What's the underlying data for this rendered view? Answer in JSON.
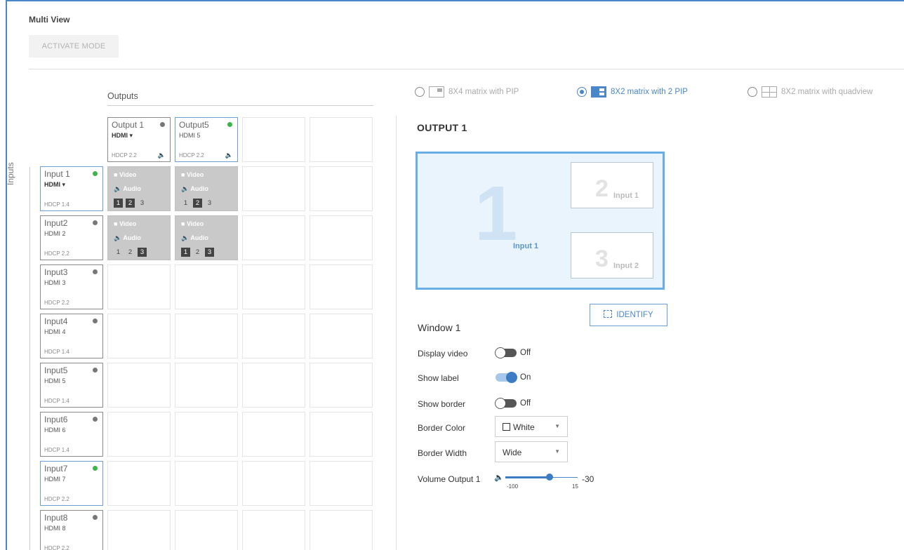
{
  "page": {
    "title": "Multi View",
    "activate_label": "ACTIVATE MODE"
  },
  "matrix": {
    "outputs_title": "Outputs",
    "inputs_label": "Inputs",
    "outputs": [
      {
        "name": "Output 1",
        "source": "HDMI ▾",
        "hdcp": "HDCP 2.2",
        "status": "gray"
      },
      {
        "name": "Output5",
        "source": "HDMI 5",
        "hdcp": "HDCP 2.2",
        "status": "green"
      }
    ],
    "inputs": [
      {
        "name": "Input 1",
        "source": "HDMI ▾",
        "hdcp": "HDCP 1.4",
        "status": "green"
      },
      {
        "name": "Input2",
        "source": "HDMI 2",
        "hdcp": "HDCP 2.2",
        "status": "gray"
      },
      {
        "name": "Input3",
        "source": "HDMI 3",
        "hdcp": "HDCP 2.2",
        "status": "gray"
      },
      {
        "name": "Input4",
        "source": "HDMI 4",
        "hdcp": "HDCP 1.4",
        "status": "gray"
      },
      {
        "name": "Input5",
        "source": "HDMI 5",
        "hdcp": "HDCP 1.4",
        "status": "gray"
      },
      {
        "name": "Input6",
        "source": "HDMI 6",
        "hdcp": "HDCP 1.4",
        "status": "gray"
      },
      {
        "name": "Input7",
        "source": "HDMI 7",
        "hdcp": "HDCP 2.2",
        "status": "green"
      },
      {
        "name": "Input8",
        "source": "HDMI 8",
        "hdcp": "HDCP 2.2",
        "status": "gray"
      }
    ],
    "crosspoint_video": "Video",
    "crosspoint_audio": "Audio",
    "crosspoints": [
      {
        "row": 0,
        "col": 0,
        "active_window": 2
      },
      {
        "row": 0,
        "col": 1,
        "active_window": 2
      },
      {
        "row": 1,
        "col": 0,
        "active_window": 3
      },
      {
        "row": 1,
        "col": 1,
        "active_window": 3
      }
    ]
  },
  "layouts": [
    {
      "label": "8X4 matrix with PIP",
      "selected": false
    },
    {
      "label": "8X2 matrix with 2 PIP",
      "selected": true
    },
    {
      "label": "8X2 matrix with quadview",
      "selected": false
    }
  ],
  "output_panel": {
    "title": "OUTPUT 1",
    "main_window": {
      "number": "1",
      "label": "Input 1"
    },
    "pip1": {
      "number": "2",
      "label": "Input 1"
    },
    "pip2": {
      "number": "3",
      "label": "Input 2"
    },
    "identify_label": "IDENTIFY",
    "window_title": "Window 1",
    "display_video": {
      "label": "Display video",
      "state": "Off"
    },
    "show_label": {
      "label": "Show label",
      "state": "On"
    },
    "show_border": {
      "label": "Show border",
      "state": "Off"
    },
    "border_color": {
      "label": "Border Color",
      "value": "White"
    },
    "border_width": {
      "label": "Border Width",
      "value": "Wide"
    },
    "volume": {
      "label": "Volume Output 1",
      "min": "-100",
      "max": "15",
      "value": "-30"
    }
  },
  "colors": {
    "accent": "#4a86c8",
    "status_green": "#3cb44b",
    "status_gray": "#777777"
  }
}
